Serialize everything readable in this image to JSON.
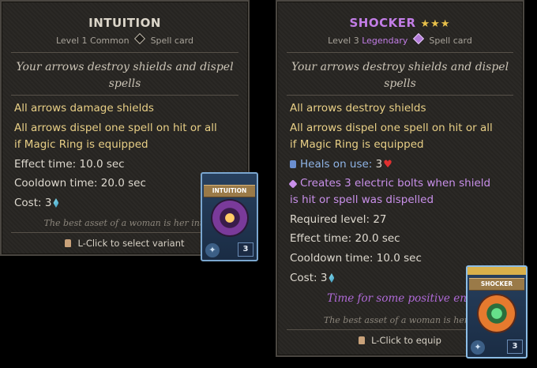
{
  "left_tooltip": {
    "title": "INTUITION",
    "level_label": "Level 1",
    "rarity": "Common",
    "card_type": "Spell card",
    "flavor": "Your arrows destroy shields and dispel spells",
    "effects": [
      "All arrows damage shields",
      "All arrows dispel one spell on hit or all",
      "if Magic Ring is equipped"
    ],
    "effect_time": "Effect time: 10.0 sec",
    "cooldown_time": "Cooldown time: 20.0 sec",
    "cost_label": "Cost: 3",
    "quote": "The best asset of a woman is her intu",
    "hint": "L-Click to select variant",
    "card_name": "INTUITION",
    "card_tier": "3"
  },
  "right_tooltip": {
    "title": "SHOCKER",
    "stars": "★★★",
    "level_label": "Level 3",
    "rarity": "Legendary",
    "card_type": "Spell card",
    "flavor": "Your arrows destroy shields and dispel spells",
    "effects": [
      "All arrows destroy shields",
      "All arrows dispel one spell on hit or all",
      "if Magic Ring is equipped"
    ],
    "heals_label": "Heals on use:",
    "heals_value": "3",
    "bolts_line1": "Creates 3 electric bolts when shield",
    "bolts_line2": "is hit or spell was dispelled",
    "required_level": "Required level: 27",
    "effect_time": "Effect time: 20.0 sec",
    "cooldown_time": "Cooldown time: 10.0 sec",
    "cost_label": "Cost: 3",
    "purple_flavor": "Time for some positive ene",
    "quote": "The best asset of a woman is her in",
    "hint": "L-Click to equip",
    "card_name": "SHOCKER",
    "card_tier": "3"
  },
  "colors": {
    "panel_bg": "#272522",
    "gold_text": "#e8cf86",
    "legendary_purple": "#c27de6",
    "body_text": "#ded9cf"
  },
  "icons": [
    "gem-icon",
    "crystal-icon",
    "heart-icon",
    "mouse-left-icon",
    "heal-icon",
    "bolt-icon"
  ]
}
